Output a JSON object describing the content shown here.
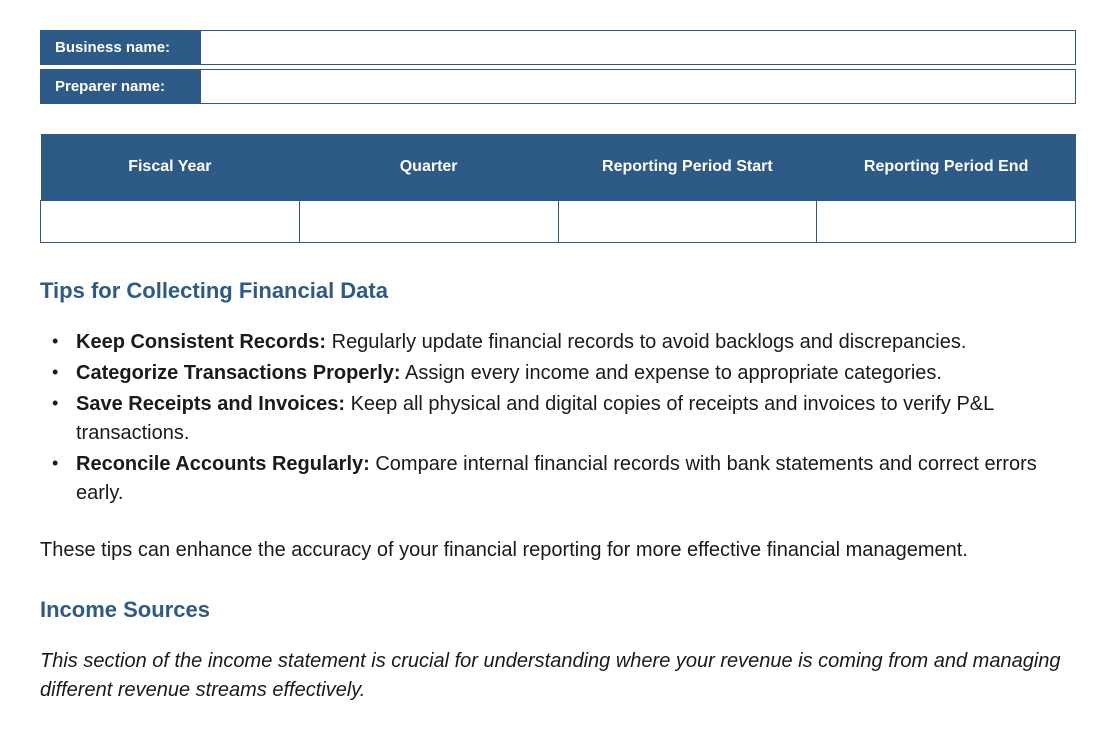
{
  "fields": {
    "business_name_label": "Business name:",
    "business_name_value": "",
    "preparer_name_label": "Preparer name:",
    "preparer_name_value": ""
  },
  "period_table": {
    "headers": [
      "Fiscal Year",
      "Quarter",
      "Reporting Period Start",
      "Reporting Period End"
    ],
    "values": [
      "",
      "",
      "",
      ""
    ]
  },
  "tips_section": {
    "heading": "Tips for Collecting Financial Data",
    "items": [
      {
        "label": "Keep Consistent Records:",
        "text": " Regularly update financial records to avoid backlogs and discrepancies."
      },
      {
        "label": "Categorize Transactions Properly:",
        "text": " Assign every income and expense to appropriate categories."
      },
      {
        "label": "Save Receipts and Invoices:",
        "text": " Keep all physical and digital copies of receipts and invoices to verify P&L transactions."
      },
      {
        "label": "Reconcile Accounts Regularly:",
        "text": " Compare internal financial records with bank statements and correct errors early."
      }
    ],
    "summary": "These tips can enhance the accuracy of your financial reporting for more effective financial management."
  },
  "income_section": {
    "heading": "Income Sources",
    "intro": "This section of the income statement is crucial for understanding where your revenue is coming from and managing different revenue streams effectively."
  }
}
